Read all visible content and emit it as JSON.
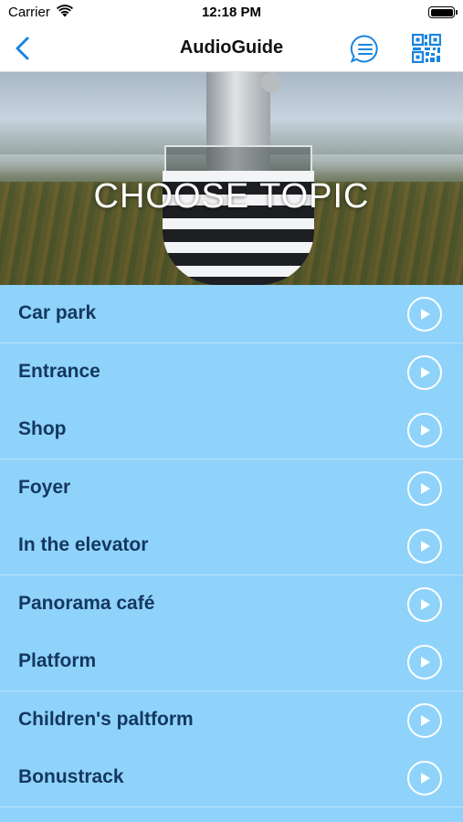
{
  "status_bar": {
    "carrier": "Carrier",
    "time": "12:18 PM"
  },
  "nav": {
    "title": "AudioGuide",
    "icons": [
      "chevron-left-icon",
      "chat-list-icon",
      "qr-code-icon"
    ]
  },
  "hero": {
    "heading": "CHOOSE TOPIC"
  },
  "topics": [
    {
      "label": "Car park"
    },
    {
      "label": "Entrance"
    },
    {
      "label": "Shop"
    },
    {
      "label": "Foyer"
    },
    {
      "label": "In the elevator"
    },
    {
      "label": "Panorama café"
    },
    {
      "label": "Platform"
    },
    {
      "label": "Children's paltform"
    },
    {
      "label": "Bonustrack"
    }
  ],
  "colors": {
    "accent": "#1a84e0",
    "list_background": "#8fd3fa",
    "list_text": "#14375f",
    "divider": "#b9e3fb"
  }
}
